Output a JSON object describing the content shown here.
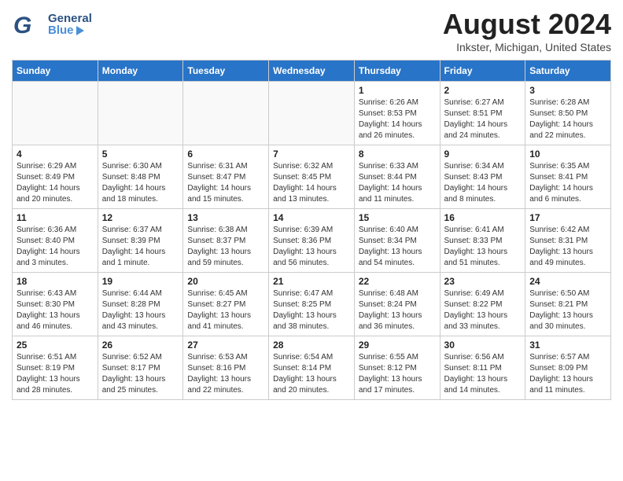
{
  "header": {
    "logo": {
      "general": "General",
      "blue": "Blue"
    },
    "title": "August 2024",
    "location": "Inkster, Michigan, United States"
  },
  "calendar": {
    "days_of_week": [
      "Sunday",
      "Monday",
      "Tuesday",
      "Wednesday",
      "Thursday",
      "Friday",
      "Saturday"
    ],
    "weeks": [
      [
        {
          "day": "",
          "info": ""
        },
        {
          "day": "",
          "info": ""
        },
        {
          "day": "",
          "info": ""
        },
        {
          "day": "",
          "info": ""
        },
        {
          "day": "1",
          "info": "Sunrise: 6:26 AM\nSunset: 8:53 PM\nDaylight: 14 hours\nand 26 minutes."
        },
        {
          "day": "2",
          "info": "Sunrise: 6:27 AM\nSunset: 8:51 PM\nDaylight: 14 hours\nand 24 minutes."
        },
        {
          "day": "3",
          "info": "Sunrise: 6:28 AM\nSunset: 8:50 PM\nDaylight: 14 hours\nand 22 minutes."
        }
      ],
      [
        {
          "day": "4",
          "info": "Sunrise: 6:29 AM\nSunset: 8:49 PM\nDaylight: 14 hours\nand 20 minutes."
        },
        {
          "day": "5",
          "info": "Sunrise: 6:30 AM\nSunset: 8:48 PM\nDaylight: 14 hours\nand 18 minutes."
        },
        {
          "day": "6",
          "info": "Sunrise: 6:31 AM\nSunset: 8:47 PM\nDaylight: 14 hours\nand 15 minutes."
        },
        {
          "day": "7",
          "info": "Sunrise: 6:32 AM\nSunset: 8:45 PM\nDaylight: 14 hours\nand 13 minutes."
        },
        {
          "day": "8",
          "info": "Sunrise: 6:33 AM\nSunset: 8:44 PM\nDaylight: 14 hours\nand 11 minutes."
        },
        {
          "day": "9",
          "info": "Sunrise: 6:34 AM\nSunset: 8:43 PM\nDaylight: 14 hours\nand 8 minutes."
        },
        {
          "day": "10",
          "info": "Sunrise: 6:35 AM\nSunset: 8:41 PM\nDaylight: 14 hours\nand 6 minutes."
        }
      ],
      [
        {
          "day": "11",
          "info": "Sunrise: 6:36 AM\nSunset: 8:40 PM\nDaylight: 14 hours\nand 3 minutes."
        },
        {
          "day": "12",
          "info": "Sunrise: 6:37 AM\nSunset: 8:39 PM\nDaylight: 14 hours\nand 1 minute."
        },
        {
          "day": "13",
          "info": "Sunrise: 6:38 AM\nSunset: 8:37 PM\nDaylight: 13 hours\nand 59 minutes."
        },
        {
          "day": "14",
          "info": "Sunrise: 6:39 AM\nSunset: 8:36 PM\nDaylight: 13 hours\nand 56 minutes."
        },
        {
          "day": "15",
          "info": "Sunrise: 6:40 AM\nSunset: 8:34 PM\nDaylight: 13 hours\nand 54 minutes."
        },
        {
          "day": "16",
          "info": "Sunrise: 6:41 AM\nSunset: 8:33 PM\nDaylight: 13 hours\nand 51 minutes."
        },
        {
          "day": "17",
          "info": "Sunrise: 6:42 AM\nSunset: 8:31 PM\nDaylight: 13 hours\nand 49 minutes."
        }
      ],
      [
        {
          "day": "18",
          "info": "Sunrise: 6:43 AM\nSunset: 8:30 PM\nDaylight: 13 hours\nand 46 minutes."
        },
        {
          "day": "19",
          "info": "Sunrise: 6:44 AM\nSunset: 8:28 PM\nDaylight: 13 hours\nand 43 minutes."
        },
        {
          "day": "20",
          "info": "Sunrise: 6:45 AM\nSunset: 8:27 PM\nDaylight: 13 hours\nand 41 minutes."
        },
        {
          "day": "21",
          "info": "Sunrise: 6:47 AM\nSunset: 8:25 PM\nDaylight: 13 hours\nand 38 minutes."
        },
        {
          "day": "22",
          "info": "Sunrise: 6:48 AM\nSunset: 8:24 PM\nDaylight: 13 hours\nand 36 minutes."
        },
        {
          "day": "23",
          "info": "Sunrise: 6:49 AM\nSunset: 8:22 PM\nDaylight: 13 hours\nand 33 minutes."
        },
        {
          "day": "24",
          "info": "Sunrise: 6:50 AM\nSunset: 8:21 PM\nDaylight: 13 hours\nand 30 minutes."
        }
      ],
      [
        {
          "day": "25",
          "info": "Sunrise: 6:51 AM\nSunset: 8:19 PM\nDaylight: 13 hours\nand 28 minutes."
        },
        {
          "day": "26",
          "info": "Sunrise: 6:52 AM\nSunset: 8:17 PM\nDaylight: 13 hours\nand 25 minutes."
        },
        {
          "day": "27",
          "info": "Sunrise: 6:53 AM\nSunset: 8:16 PM\nDaylight: 13 hours\nand 22 minutes."
        },
        {
          "day": "28",
          "info": "Sunrise: 6:54 AM\nSunset: 8:14 PM\nDaylight: 13 hours\nand 20 minutes."
        },
        {
          "day": "29",
          "info": "Sunrise: 6:55 AM\nSunset: 8:12 PM\nDaylight: 13 hours\nand 17 minutes."
        },
        {
          "day": "30",
          "info": "Sunrise: 6:56 AM\nSunset: 8:11 PM\nDaylight: 13 hours\nand 14 minutes."
        },
        {
          "day": "31",
          "info": "Sunrise: 6:57 AM\nSunset: 8:09 PM\nDaylight: 13 hours\nand 11 minutes."
        }
      ]
    ]
  }
}
